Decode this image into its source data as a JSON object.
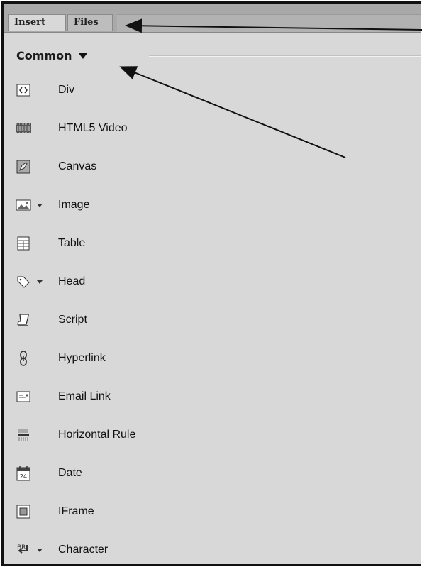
{
  "tabs": [
    {
      "label": "Insert"
    },
    {
      "label": "Files"
    }
  ],
  "category": {
    "label": "Common"
  },
  "items": [
    {
      "label": "Div",
      "icon": "div-icon"
    },
    {
      "label": "HTML5 Video",
      "icon": "video-icon"
    },
    {
      "label": "Canvas",
      "icon": "canvas-icon"
    },
    {
      "label": "Image",
      "icon": "image-icon"
    },
    {
      "label": "Table",
      "icon": "table-icon"
    },
    {
      "label": "Head",
      "icon": "tag-icon"
    },
    {
      "label": "Script",
      "icon": "script-icon"
    },
    {
      "label": "Hyperlink",
      "icon": "hyperlink-icon"
    },
    {
      "label": "Email Link",
      "icon": "email-icon"
    },
    {
      "label": "Horizontal Rule",
      "icon": "horizontal-rule-icon"
    },
    {
      "label": "Date",
      "icon": "calendar-icon"
    },
    {
      "label": "IFrame",
      "icon": "iframe-icon"
    },
    {
      "label": "Character",
      "icon": "character-icon"
    }
  ],
  "icon_text": {
    "date": "24",
    "character": "BR"
  },
  "colors": {
    "panel": "#d8d8d8",
    "tabbar": "#a9a9a9",
    "text": "#111111"
  }
}
